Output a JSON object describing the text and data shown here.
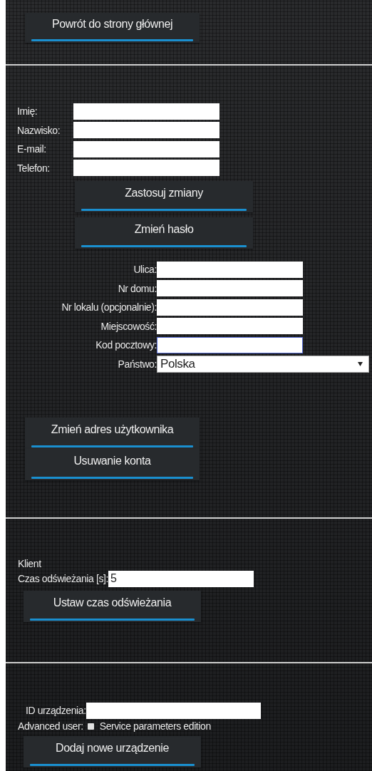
{
  "back_button": {
    "label": "Powrót do strony głównej"
  },
  "personal": {
    "fields": [
      {
        "label": "Imię:"
      },
      {
        "label": "Nazwisko:"
      },
      {
        "label": "E-mail:"
      },
      {
        "label": "Telefon:"
      }
    ],
    "buttons": [
      "Zastosuj zmiany",
      "Zmień hasło"
    ]
  },
  "address": {
    "fields": [
      {
        "label": "Ulica:",
        "kind": "text",
        "focused": false
      },
      {
        "label": "Nr domu:",
        "kind": "text",
        "focused": false
      },
      {
        "label": "Nr lokalu (opcjonalnie):",
        "kind": "text",
        "focused": false
      },
      {
        "label": "Miejscowość:",
        "kind": "text",
        "focused": false
      },
      {
        "label": "Kod pocztowy:",
        "kind": "text",
        "focused": true
      },
      {
        "label": "Państwo:",
        "kind": "select",
        "value": "Polska",
        "focused": false
      }
    ],
    "buttons": [
      "Zmień adres użytkownika",
      "Usuwanie konta"
    ]
  },
  "client": {
    "heading": "Klient",
    "refresh": {
      "label": "Czas odświeżania [s]:",
      "value": "5"
    },
    "button": "Ustaw czas odświeżania"
  },
  "device": {
    "id_label": "ID urządzenia:",
    "advanced_label": "Advanced user:",
    "checkbox": {
      "label": "Service parameters edition",
      "checked": false
    },
    "button": "Dodaj nowe urządzenie"
  }
}
